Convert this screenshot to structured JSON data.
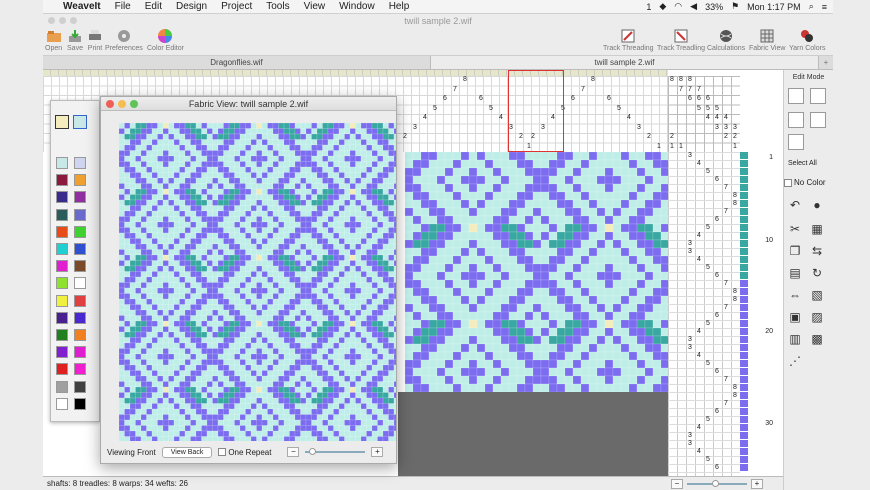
{
  "menubar": {
    "app": "WeaveIt",
    "items": [
      "File",
      "Edit",
      "Design",
      "Project",
      "Tools",
      "View",
      "Window",
      "Help"
    ],
    "battery": "33%",
    "clock": "Mon 1:17 PM",
    "notifications": "1"
  },
  "window": {
    "title": "twill sample 2.wif"
  },
  "toolbar": {
    "open": "Open",
    "save": "Save",
    "print": "Print",
    "preferences": "Preferences",
    "color_editor": "Color Editor",
    "track_threading": "Track Threading",
    "track_treadling": "Track Treadling",
    "calculations": "Calculations",
    "fabric_view": "Fabric View",
    "yarn_colors": "Yarn Colors"
  },
  "tabs": [
    "Dragonflies.wif",
    "twill sample 2.wif"
  ],
  "right_panel": {
    "title": "Edit Mode",
    "select_all": "Select All",
    "no_color": "No Color",
    "row_numbers": [
      "1",
      "10",
      "20",
      "30"
    ]
  },
  "fabric_window": {
    "title": "Fabric View: twill sample 2.wif",
    "viewing": "Viewing Front",
    "view_back": "View Back",
    "one_repeat": "One Repeat"
  },
  "status": {
    "text": "shafts: 8  treadles: 8  warps: 34  wefts: 26"
  },
  "colors": {
    "purple": "#7b6cf0",
    "teal": "#3aa8a2",
    "mint": "#bfeee8",
    "cream": "#f4ecbc"
  },
  "palette": [
    "#c7e8e6",
    "#cfd5f0",
    "#8c1a3c",
    "#f0a030",
    "#3a2a8c",
    "#9030a0",
    "#2a5c5c",
    "#6a6acc",
    "#e84a1a",
    "#40d030",
    "#20d0d0",
    "#3050d0",
    "#e020d0",
    "#7a4a2a",
    "#90e030",
    "#ffffff",
    "#f0f040",
    "#e04040",
    "#4a2090",
    "#4a2ad0",
    "#208020",
    "#f08020",
    "#8020d0",
    "#e020d0",
    "#e02020",
    "#f020d0",
    "#a0a0a0",
    "#404040",
    "#ffffff",
    "#000000"
  ],
  "threading_numbers": [
    "8",
    "7",
    "6",
    "5",
    "4",
    "3",
    "2",
    "1"
  ],
  "treadling_numbers": [
    "3",
    "4",
    "5",
    "6",
    "7",
    "8"
  ]
}
